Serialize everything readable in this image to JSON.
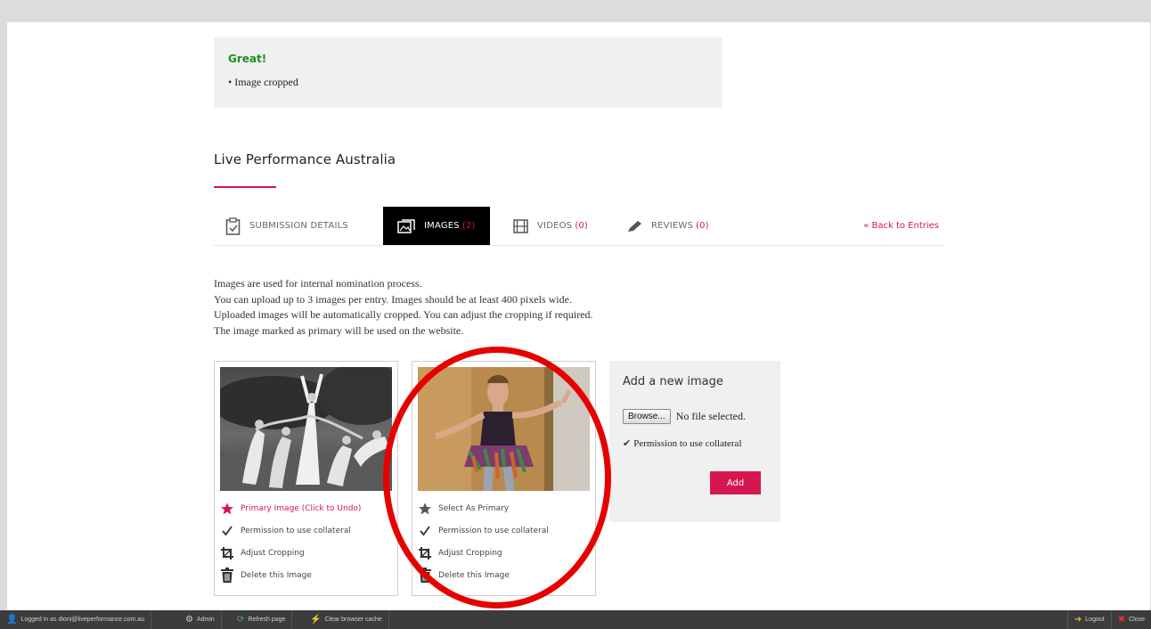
{
  "alert": {
    "title": "Great!",
    "items": [
      "Image cropped"
    ]
  },
  "entry": {
    "title": "Live Performance Australia"
  },
  "tabs": [
    {
      "label": "SUBMISSION DETAILS",
      "icon": "clipboard-check-icon",
      "count": ""
    },
    {
      "label": "IMAGES",
      "icon": "images-icon",
      "count": "(2)"
    },
    {
      "label": "VIDEOS",
      "icon": "film-icon",
      "count": "(0)"
    },
    {
      "label": "REVIEWS",
      "icon": "pen-icon",
      "count": "(0)"
    }
  ],
  "back_link": "« Back to Entries",
  "intro": [
    "Images are used for internal nomination process.",
    "You can upload up to 3 images per entry. Images should be at least 400 pixels wide.",
    "Uploaded images will be automatically cropped. You can adjust the cropping if required.",
    "The image marked as primary will be used on the website."
  ],
  "images": [
    {
      "alt": "Black and white photo of dancers in flowing dresses",
      "primary_label": "Primary Image (Click to Undo)",
      "permission_label": "Permission to use collateral",
      "crop_label": "Adjust Cropping",
      "delete_label": "Delete this Image"
    },
    {
      "alt": "Colour photo of a performer in a tutu",
      "primary_label": "Select As Primary",
      "permission_label": "Permission to use collateral",
      "crop_label": "Adjust Cropping",
      "delete_label": "Delete this Image"
    }
  ],
  "add_image": {
    "title": "Add a new image",
    "browse_label": "Browse...",
    "no_file": "No file selected.",
    "permission_label": "Permission to use collateral",
    "add_label": "Add"
  },
  "toolbar": {
    "logged_in": "Logged in as dioni@liveperformance.com.au",
    "admin": "Admin",
    "refresh": "Refresh page",
    "clear_cache": "Clear browser cache",
    "logout": "Logout",
    "close": "Close"
  },
  "colors": {
    "accent": "#d6174f",
    "success": "#1f8f1f",
    "toolbar_bg": "#3c3c3c",
    "highlight": "#e60000"
  }
}
